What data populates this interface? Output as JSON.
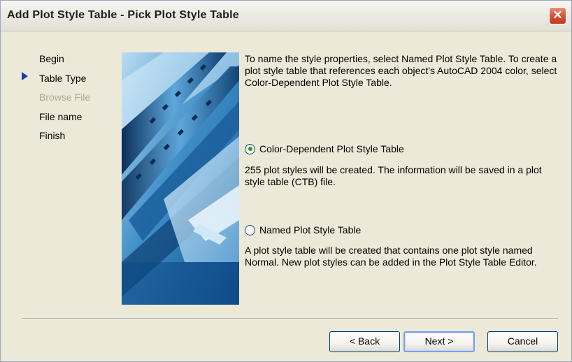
{
  "window": {
    "title": "Add Plot Style Table - Pick Plot Style Table",
    "close_glyph": "✕"
  },
  "steps": [
    {
      "label": "Begin",
      "state": "normal"
    },
    {
      "label": "Table Type",
      "state": "current"
    },
    {
      "label": "Browse File",
      "state": "disabled"
    },
    {
      "label": "File name",
      "state": "normal"
    },
    {
      "label": "Finish",
      "state": "normal"
    }
  ],
  "description": "To name the style properties, select Named Plot Style Table. To create a plot style table that references each object's AutoCAD 2004 color, select Color-Dependent Plot Style Table.",
  "options": [
    {
      "label": "Color-Dependent Plot Style Table",
      "selected": true,
      "info": "255 plot styles will be created. The information will be saved in a plot style table (CTB) file."
    },
    {
      "label": "Named Plot Style Table",
      "selected": false,
      "info": "A plot style table will be created that contains one plot style named Normal.  New plot styles can be added in the Plot Style Table Editor."
    }
  ],
  "buttons": {
    "back": "< Back",
    "next": "Next >",
    "cancel": "Cancel"
  },
  "colors": {
    "accent": "#1a3fa3",
    "radio_selected": "#2a9a2a",
    "close": "#d9583a"
  }
}
